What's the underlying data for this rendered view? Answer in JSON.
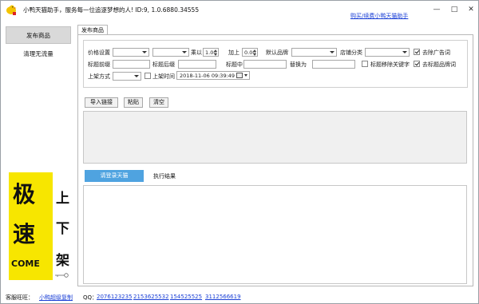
{
  "window": {
    "title": "小鸭天猫助手，服务每一位追逐梦想的人! ID:9, 1.0.6880.34555",
    "buy_link": "购买/续费小鸭天猫助手",
    "controls": {
      "minimize": "—",
      "maximize": "□",
      "close": "✕"
    }
  },
  "sidebar": {
    "items": [
      {
        "label": "发布商品",
        "active": true
      },
      {
        "label": "清理无流量",
        "active": false
      }
    ]
  },
  "promo": {
    "left_chars": [
      "极",
      "速"
    ],
    "left_word": "COME",
    "right_chars": [
      "上",
      "下",
      "架"
    ]
  },
  "main": {
    "tab_label": "发布商品",
    "settings": {
      "price_label": "价格设置",
      "multiply_label": "乘以",
      "multiply_value": "1.00",
      "add_label": "加上",
      "add_value": "0.00",
      "default_brand_label": "默认品牌",
      "store_category_label": "店铺分类",
      "remove_ads_label": "去除广告词",
      "remove_ads_checked": true,
      "title_prefix_label": "标题前缀",
      "title_suffix_label": "标题后缀",
      "title_contains_label": "标题中",
      "replace_label": "替换为",
      "remove_keyword_label": "标题移除关键字",
      "remove_keyword_checked": false,
      "remove_brand_label": "去标题品牌词",
      "remove_brand_checked": true,
      "listing_method_label": "上架方式",
      "listing_time_label": "上架时间",
      "listing_time_checked": false,
      "listing_time_value": "2018-11-06  09:39:49"
    },
    "buttons": {
      "import_link": "导入链接",
      "paste": "粘贴",
      "clear": "清空"
    },
    "login_button": "请登录天猫",
    "result_tab": "执行结果"
  },
  "footer": {
    "customer_wangwang_label": "客服旺旺：",
    "customer_wangwang_link": "小鸭超级复制",
    "qq_label": "QQ：",
    "qq_numbers": [
      "2076123235",
      "2153625532",
      "154525525",
      "3112566619"
    ]
  }
}
